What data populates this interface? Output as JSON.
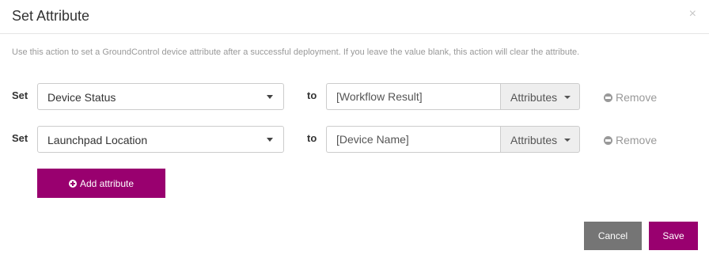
{
  "modal": {
    "title": "Set Attribute",
    "close_symbol": "×",
    "description": "Use this action to set a GroundControl device attribute after a successful deployment. If you leave the value blank, this action will clear the attribute."
  },
  "rows": [
    {
      "set_label": "Set",
      "attribute": "Device Status",
      "to_label": "to",
      "value": "[Workflow Result]",
      "attributes_dropdown_label": "Attributes",
      "remove_label": "Remove"
    },
    {
      "set_label": "Set",
      "attribute": "Launchpad Location",
      "to_label": "to",
      "value": "[Device Name]",
      "attributes_dropdown_label": "Attributes",
      "remove_label": "Remove"
    }
  ],
  "actions": {
    "add_attribute_label": "Add attribute",
    "cancel_label": "Cancel",
    "save_label": "Save"
  },
  "icons": {
    "close": "close-icon",
    "remove": "minus-circle-icon",
    "add": "plus-circle-icon",
    "select_caret": "caret-down-icon"
  },
  "colors": {
    "accent": "#99006f",
    "cancel": "#757575",
    "muted_text": "#999999"
  }
}
